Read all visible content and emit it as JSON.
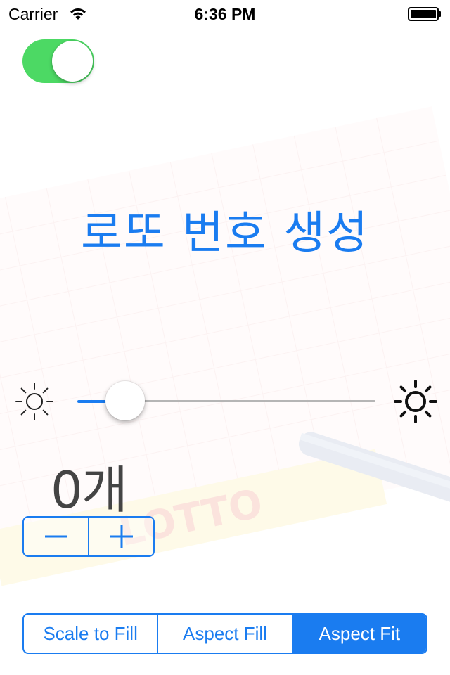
{
  "status_bar": {
    "carrier": "Carrier",
    "time": "6:36 PM",
    "icons": [
      "wifi-icon",
      "battery-icon"
    ]
  },
  "toggle": {
    "on": true,
    "color": "#4cd964"
  },
  "title": "로또 번호 생성",
  "slider": {
    "value": 0.1,
    "min_icon": "sun-small-icon",
    "max_icon": "sun-large-icon",
    "tint": "#1a7cf0"
  },
  "count_label": "0개",
  "stepper": {
    "minus_icon": "minus-icon",
    "plus_icon": "plus-icon"
  },
  "segmented": {
    "options": [
      "Scale to Fill",
      "Aspect Fill",
      "Aspect Fit"
    ],
    "selected": "Aspect Fit"
  },
  "colors": {
    "accent": "#1a7cf0",
    "switch_on": "#4cd964"
  }
}
